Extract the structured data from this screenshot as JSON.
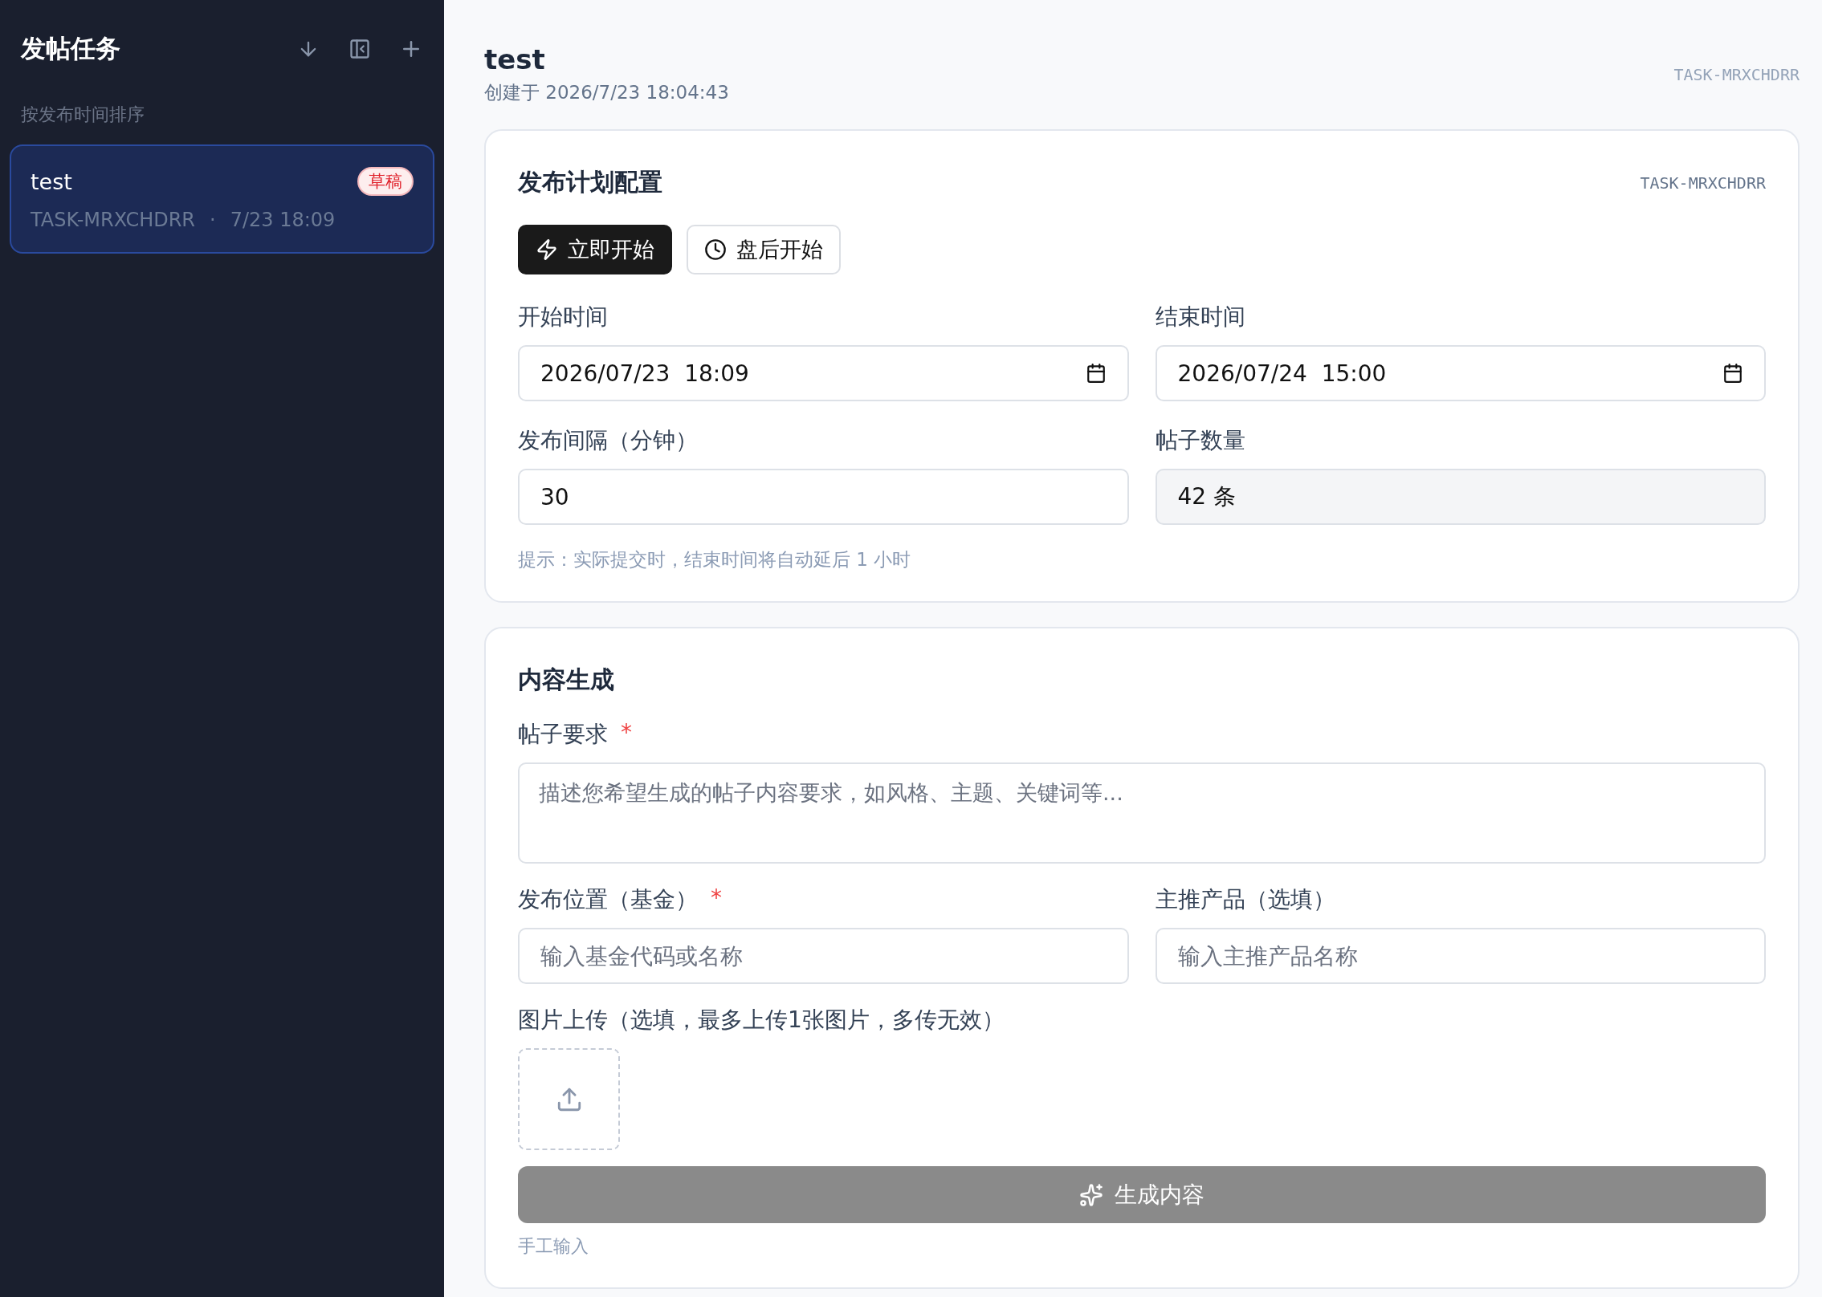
{
  "sidebar": {
    "title": "发帖任务",
    "sort_label": "按发布时间排序",
    "tasks": [
      {
        "title": "test",
        "status": "草稿",
        "id": "TASK-MRXCHDRR",
        "separator": "·",
        "time": "7/23 18:09",
        "selected": true
      }
    ]
  },
  "header": {
    "title": "test",
    "created": "创建于 2026/7/23 18:04:43",
    "task_id": "TASK-MRXCHDRR"
  },
  "schedule": {
    "heading": "发布计划配置",
    "task_id": "TASK-MRXCHDRR",
    "modes": [
      {
        "kind": "now",
        "label": "立即开始",
        "selected": true
      },
      {
        "kind": "after_close",
        "label": "盘后开始",
        "selected": false
      }
    ],
    "fields": [
      {
        "kind": "datetime",
        "label": "开始时间",
        "value": "2026/07/23  18:09"
      },
      {
        "kind": "datetime",
        "label": "结束时间",
        "value": "2026/07/24  15:00"
      },
      {
        "kind": "number",
        "label": "发布间隔（分钟）",
        "value": "30"
      },
      {
        "kind": "readonly",
        "label": "帖子数量",
        "value": "42 条"
      }
    ],
    "hint": "提示：实际提交时，结束时间将自动延后 1 小时"
  },
  "content": {
    "heading": "内容生成",
    "requirement": {
      "label": "帖子要求",
      "required_mark": "*",
      "placeholder": "描述您希望生成的帖子内容要求，如风格、主题、关键词等..."
    },
    "fields": [
      {
        "label": "发布位置（基金）",
        "required_mark": "*",
        "placeholder": "输入基金代码或名称"
      },
      {
        "label": "主推产品（选填）",
        "placeholder": "输入主推产品名称"
      }
    ],
    "upload": {
      "label": "图片上传（选填，最多上传1张图片，多传无效）"
    },
    "generate_button": {
      "label": "生成内容",
      "disabled": true
    },
    "manual_label": "手工输入"
  }
}
